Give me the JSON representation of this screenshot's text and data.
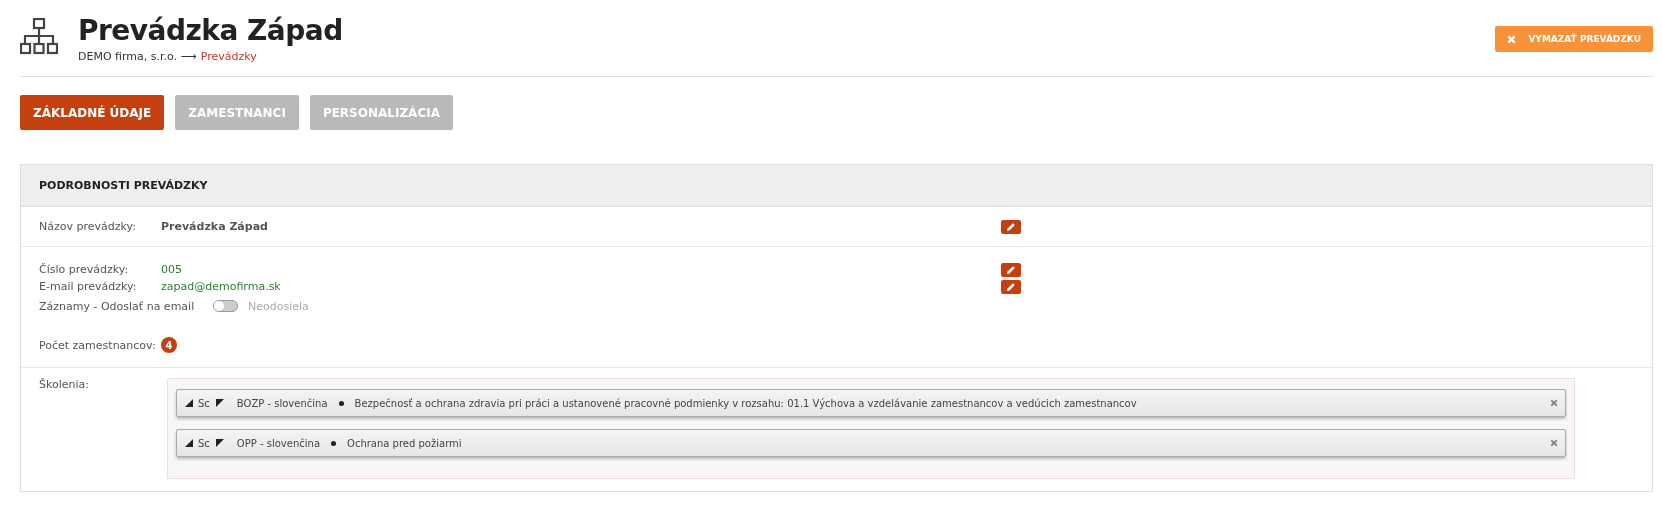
{
  "header": {
    "title": "Prevádzka Západ",
    "breadcrumb_separator": "⟶",
    "breadcrumb": [
      {
        "label": "DEMO firma, s.r.o.",
        "link": false
      },
      {
        "label": "Prevádzky",
        "link": true
      }
    ],
    "delete_button": "VYMAZAŤ PREVÁDZKU"
  },
  "tabs": [
    {
      "label": "ZÁKLADNÉ ÚDAJE",
      "selected": true
    },
    {
      "label": "ZAMESTNANCI",
      "selected": false
    },
    {
      "label": "PERSONALIZÁCIA",
      "selected": false
    }
  ],
  "panel": {
    "title": "PODROBNOSTI PREVÁDZKY",
    "sections": [
      {
        "rows": [
          {
            "kind": "field",
            "label": "Názov prevádzky:",
            "value": "Prevádzka Západ",
            "bold": true,
            "editable": true
          }
        ]
      },
      {
        "rows": [
          {
            "kind": "field",
            "label": "Číslo prevádzky:",
            "value": "005",
            "bold": false,
            "editable": true
          },
          {
            "kind": "field",
            "label": "E-mail prevádzky:",
            "value": "zapad@demofirma.sk",
            "bold": false,
            "editable": true
          },
          {
            "kind": "toggle",
            "label": "Záznamy - Odoslať na email",
            "on": false,
            "state_label": "Neodosiela"
          },
          {
            "kind": "count",
            "label": "Počet zamestnancov:",
            "count": "4"
          }
        ]
      }
    ],
    "trainings": {
      "label": "Školenia:",
      "items": [
        {
          "prefix": "Sc",
          "code": "BOZP - slovenčina",
          "description": "Bezpečnosť a ochrana zdravia pri práci a ustanovené pracovné podmienky v rozsahu: 01.1 Výchova a vzdelávanie zamestnancov a vedúcich zamestnancov"
        },
        {
          "prefix": "Sc",
          "code": "OPP - slovenčina",
          "description": "Ochrana pred požiarmi"
        }
      ]
    }
  }
}
